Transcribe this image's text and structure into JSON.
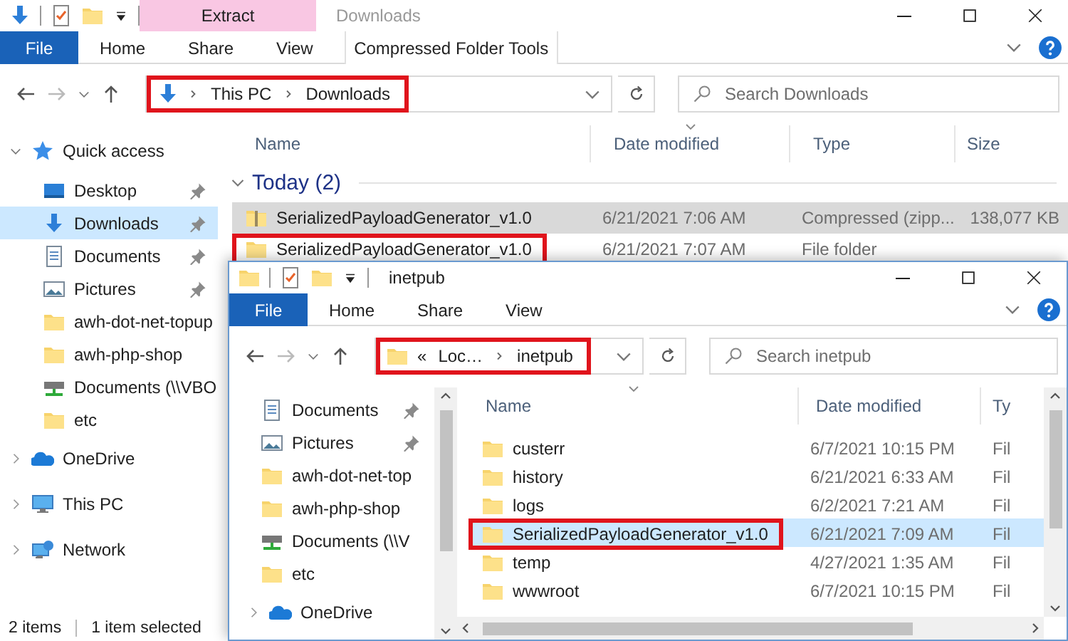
{
  "back_window": {
    "title": "Downloads",
    "active": false,
    "ribbon_tabs": [
      {
        "label": "File",
        "kind": "file"
      },
      {
        "label": "Home",
        "kind": "plain"
      },
      {
        "label": "Share",
        "kind": "plain"
      },
      {
        "label": "View",
        "kind": "plain"
      },
      {
        "label": "Compressed Folder Tools",
        "kind": "context",
        "group": "Extract"
      }
    ],
    "address": {
      "kind": "download",
      "crumbs": [
        "This PC",
        "Downloads"
      ],
      "highlighted": true
    },
    "search": {
      "placeholder": "Search Downloads"
    },
    "nav": [
      {
        "label": "Quick access",
        "kind": "star",
        "expanded": true,
        "children": [
          {
            "label": "Desktop",
            "kind": "desktop",
            "pinned": true,
            "selected": false
          },
          {
            "label": "Downloads",
            "kind": "download",
            "pinned": true,
            "selected": true
          },
          {
            "label": "Documents",
            "kind": "documents",
            "pinned": true,
            "selected": false
          },
          {
            "label": "Pictures",
            "kind": "pictures",
            "pinned": true,
            "selected": false
          },
          {
            "label": "awh-dot-net-topup",
            "kind": "folder",
            "pinned": false,
            "selected": false
          },
          {
            "label": "awh-php-shop",
            "kind": "folder",
            "pinned": false,
            "selected": false
          },
          {
            "label": "Documents (\\\\VBO",
            "kind": "netdrive",
            "pinned": false,
            "selected": false
          },
          {
            "label": "etc",
            "kind": "folder",
            "pinned": false,
            "selected": false
          }
        ]
      },
      {
        "label": "OneDrive",
        "kind": "onedrive",
        "expanded": false
      },
      {
        "label": "This PC",
        "kind": "pc",
        "expanded": false
      },
      {
        "label": "Network",
        "kind": "network",
        "expanded": false
      }
    ],
    "columns": [
      {
        "label": "Name",
        "sorted": false
      },
      {
        "label": "Date modified",
        "sorted": true
      },
      {
        "label": "Type",
        "sorted": false
      },
      {
        "label": "Size",
        "sorted": false
      }
    ],
    "group": {
      "label": "Today (2)",
      "expanded": true
    },
    "rows": [
      {
        "kind": "zip",
        "name": "SerializedPayloadGenerator_v1.0",
        "date": "6/21/2021 7:06 AM",
        "type": "Compressed (zipp...",
        "size": "138,077 KB",
        "selected": true,
        "highlighted": false
      },
      {
        "kind": "folder",
        "name": "SerializedPayloadGenerator_v1.0",
        "date": "6/21/2021 7:07 AM",
        "type": "File folder",
        "selected": false,
        "highlighted": true
      }
    ],
    "status_bar": [
      "2 items",
      "1 item selected"
    ]
  },
  "front_window": {
    "title": "inetpub",
    "active": true,
    "ribbon_tabs": [
      {
        "label": "File",
        "kind": "file"
      },
      {
        "label": "Home",
        "kind": "plain"
      },
      {
        "label": "Share",
        "kind": "plain"
      },
      {
        "label": "View",
        "kind": "plain"
      }
    ],
    "address": {
      "kind": "folder",
      "overflow": "«",
      "crumbs": [
        "Loc…",
        "inetpub"
      ],
      "highlighted": true
    },
    "search": {
      "placeholder": "Search inetpub"
    },
    "nav": [
      {
        "label": "Documents",
        "kind": "documents",
        "pinned": true,
        "selected": false
      },
      {
        "label": "Pictures",
        "kind": "pictures",
        "pinned": true,
        "selected": false
      },
      {
        "label": "awh-dot-net-top",
        "kind": "folder",
        "pinned": false,
        "selected": false
      },
      {
        "label": "awh-php-shop",
        "kind": "folder",
        "pinned": false,
        "selected": false
      },
      {
        "label": "Documents (\\\\V",
        "kind": "netdrive",
        "pinned": false,
        "selected": false
      },
      {
        "label": "etc",
        "kind": "folder",
        "pinned": false,
        "selected": false
      },
      {
        "label": "OneDrive",
        "kind": "onedrive",
        "expanded": false
      }
    ],
    "columns": [
      {
        "label": "Name",
        "sorted": true
      },
      {
        "label": "Date modified",
        "sorted": false
      },
      {
        "label": "Ty",
        "sorted": false
      }
    ],
    "rows": [
      {
        "kind": "folder",
        "name": "custerr",
        "date": "6/7/2021 10:15 PM",
        "type": "Fil",
        "selected": false,
        "highlighted": false
      },
      {
        "kind": "folder",
        "name": "history",
        "date": "6/21/2021 6:33 AM",
        "type": "Fil",
        "selected": false,
        "highlighted": false
      },
      {
        "kind": "folder",
        "name": "logs",
        "date": "6/2/2021 7:21 AM",
        "type": "Fil",
        "selected": false,
        "highlighted": false
      },
      {
        "kind": "folder",
        "name": "SerializedPayloadGenerator_v1.0",
        "date": "6/21/2021 7:09 AM",
        "type": "Fil",
        "selected": true,
        "highlighted": true
      },
      {
        "kind": "folder",
        "name": "temp",
        "date": "4/27/2021 1:35 AM",
        "type": "Fil",
        "selected": false,
        "highlighted": false
      },
      {
        "kind": "folder",
        "name": "wwwroot",
        "date": "6/7/2021 10:15 PM",
        "type": "Fil",
        "selected": false,
        "highlighted": false
      }
    ]
  }
}
